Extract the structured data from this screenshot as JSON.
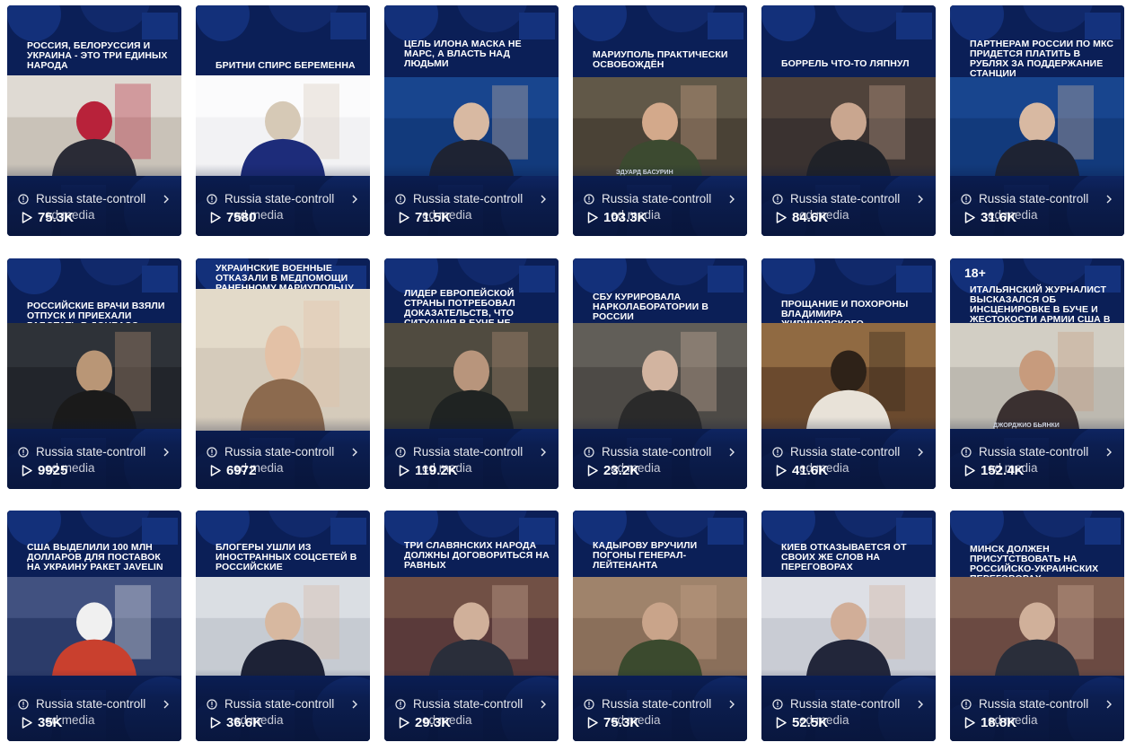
{
  "label_line1": "Russia state-controll",
  "label_line2": "ed media",
  "colors": {
    "card_bg": "#0b1f57",
    "card_accent": "#1b3a8a",
    "text": "#ffffff"
  },
  "icons": {
    "label": "info-circle-icon",
    "more": "chevron-right-icon",
    "views": "play-icon"
  },
  "videos": [
    {
      "headline": "РОССИЯ, БЕЛОРУССИЯ И УКРАИНА - ЭТО ТРИ ЕДИНЫХ НАРОДА",
      "views": "75.3K"
    },
    {
      "headline": "БРИТНИ СПИРС БЕРЕМЕННА",
      "views": "7580"
    },
    {
      "headline": "ЦЕЛЬ ИЛОНА МАСКА НЕ МАРС, А ВЛАСТЬ НАД ЛЮДЬМИ",
      "views": "71.5K"
    },
    {
      "headline": "МАРИУПОЛЬ ПРАКТИЧЕСКИ ОСВОБОЖДЁН",
      "views": "103.3K",
      "caption": "ЭДУАРД БАСУРИН"
    },
    {
      "headline": "БОРРЕЛЬ ЧТО-ТО ЛЯПНУЛ",
      "views": "84.6K"
    },
    {
      "headline": "ПАРТНЕРАМ РОССИИ ПО МКС ПРИДЕТСЯ ПЛАТИТЬ В РУБЛЯХ ЗА ПОДДЕРЖАНИЕ СТАНЦИИ",
      "views": "31.6K"
    },
    {
      "headline": "РОССИЙСКИЕ ВРАЧИ ВЗЯЛИ ОТПУСК И ПРИЕХАЛИ РАБОТАТЬ В ДОНБАСС",
      "views": "9925"
    },
    {
      "headline": "УКРАИНСКИЕ ВОЕННЫЕ ОТКАЗАЛИ В МЕДПОМОЩИ РАНЕННОМУ МАРИУПОЛЬЦУ",
      "views": "6972"
    },
    {
      "headline": "ЛИДЕР ЕВРОПЕЙСКОЙ СТРАНЫ ПОТРЕБОВАЛ ДОКАЗАТЕЛЬСТВ, ЧТО СИТУАЦИЯ В БУЧЕ НЕ ПОСТАНОВКА",
      "views": "119.2K"
    },
    {
      "headline": "СБУ КУРИРОВАЛА НАРКОЛАБОРАТОРИИ В РОССИИ",
      "views": "23.2K"
    },
    {
      "headline": "ПРОЩАНИЕ И ПОХОРОНЫ ВЛАДИМИРА ЖИРИНОВСКОГО",
      "views": "41.6K"
    },
    {
      "headline": "ИТАЛЬЯНСКИЙ ЖУРНАЛИСТ ВЫСКАЗАЛСЯ ОБ ИНСЦЕНИРОВКЕ В БУЧЕ И ЖЕСТОКОСТИ АРМИИ США В АФГАНИСТАНЕ",
      "views": "152.4K",
      "badge": "18+",
      "caption": "ДЖОРДЖИО БЬЯНКИ"
    },
    {
      "headline": "США ВЫДЕЛИЛИ 100 МЛН ДОЛЛАРОВ ДЛЯ ПОСТАВОК НА УКРАИНУ РАКЕТ JAVELIN",
      "views": "35K"
    },
    {
      "headline": "БЛОГЕРЫ УШЛИ ИЗ ИНОСТРАННЫХ СОЦСЕТЕЙ В РОССИЙСКИЕ",
      "views": "36.6K"
    },
    {
      "headline": "ТРИ СЛАВЯНСКИХ НАРОДА ДОЛЖНЫ ДОГОВОРИТЬСЯ НА РАВНЫХ",
      "views": "29.3K"
    },
    {
      "headline": "КАДЫРОВУ ВРУЧИЛИ ПОГОНЫ ГЕНЕРАЛ-ЛЕЙТЕНАНТА",
      "views": "75.3K"
    },
    {
      "headline": "КИЕВ ОТКАЗЫВАЕТСЯ ОТ СВОИХ ЖЕ СЛОВ НА ПЕРЕГОВОРАХ",
      "views": "52.5K"
    },
    {
      "headline": "МИНСК ДОЛЖЕН ПРИСУТСТВОВАТЬ НА РОССИЙСКО-УКРАИНСКИХ ПЕРЕГОВОРАХ",
      "views": "18.8K"
    }
  ]
}
